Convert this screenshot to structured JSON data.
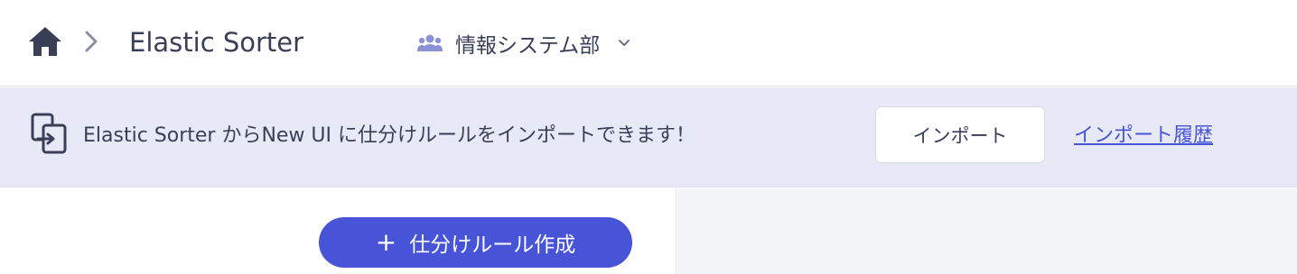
{
  "header": {
    "home_icon": "home-icon",
    "separator_icon": "chevron-right-icon",
    "app_title": "Elastic Sorter",
    "group_selector": {
      "icon": "users-icon",
      "label": "情報システム部",
      "dropdown_icon": "chevron-down-icon"
    }
  },
  "banner": {
    "icon": "import-icon",
    "message": "Elastic Sorter からNew UI に仕分けルールをインポートできます！",
    "import_button_label": "インポート",
    "history_link_label": "インポート履歴"
  },
  "main": {
    "create_rule_button": {
      "icon": "plus-icon",
      "icon_glyph": "+",
      "label": "仕分けルール作成"
    }
  },
  "colors": {
    "primary": "#4754d8",
    "banner_background": "#e8e9f7",
    "text": "#3a3f58",
    "link": "#4655d6",
    "right_panel_background": "#f3f4f8"
  }
}
